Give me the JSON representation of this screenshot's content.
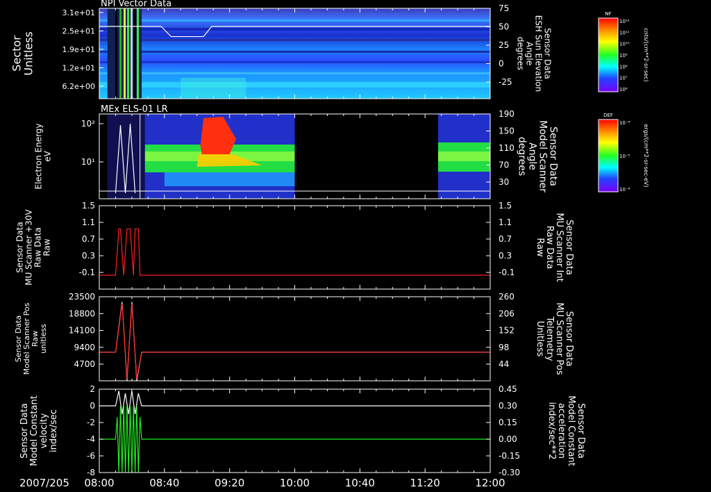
{
  "date_label": "2007/205",
  "x_ticks": [
    "08:00",
    "08:40",
    "09:20",
    "10:00",
    "10:40",
    "11:20",
    "12:00"
  ],
  "colors": {
    "white": "#ffffff",
    "red": "#ff2020",
    "green": "#22ee22",
    "background": "#000000"
  },
  "colorbars": [
    {
      "label": "NF",
      "units": "cnts/(cm**2-sr-sec)",
      "ticks": [
        "10¹²",
        "10¹¹",
        "10¹⁰",
        "10⁹",
        "10⁸",
        "10⁷",
        "10⁶"
      ]
    },
    {
      "label": "DEF",
      "units": "ergs/(cm**2-sr-sec-eV)",
      "ticks": [
        "10⁻⁴",
        "10⁻⁵",
        "10⁻⁶"
      ]
    }
  ],
  "chart_data": [
    {
      "type": "heatmap",
      "title": "NPI Vector Data",
      "ylabel_lines": [
        "Sector",
        "Unitless"
      ],
      "y_ticks": [
        "3.1e+01",
        "2.5e+01",
        "1.9e+01",
        "1.2e+01",
        "6.2e+00"
      ],
      "right_label_lines": [
        "Sensor Data",
        "ESH Sun Elevation",
        "Angle",
        "degrees"
      ],
      "right_ticks": [
        "75",
        "50",
        "25",
        "0",
        "-25"
      ],
      "ylim_right": [
        -50,
        75
      ],
      "overlay": {
        "name": "ESH Sun Elevation Angle",
        "color": "white",
        "x": [
          "08:00",
          "08:19",
          "08:20",
          "08:38",
          "08:44",
          "09:04",
          "09:09",
          "12:00"
        ],
        "y": [
          50,
          50,
          50,
          50,
          36,
          36,
          50,
          50
        ]
      }
    },
    {
      "type": "heatmap",
      "title": "MEx ELS-01 LR",
      "ylabel_lines": [
        "Electron Energy",
        "eV"
      ],
      "y_ticks": [
        "10²",
        "10¹"
      ],
      "ylim": [
        1,
        200
      ],
      "right_label_lines": [
        "Sensor Data",
        "Model Scanner",
        "Angle",
        "degrees"
      ],
      "right_ticks": [
        "190",
        "150",
        "110",
        "70",
        "30"
      ],
      "ylim_right": [
        10,
        190
      ],
      "data_gaps": [
        [
          "10:00",
          "11:28"
        ]
      ]
    },
    {
      "type": "line",
      "ylabel_lines": [
        "Sensor Data",
        "MU Scanner +30V",
        "Raw Data",
        "Raw"
      ],
      "y_ticks": [
        "1.5",
        "1.1",
        "0.7",
        "0.3",
        "-0.1"
      ],
      "ylim": [
        -0.3,
        1.5
      ],
      "right_label_lines": [
        "Sensor Data",
        "MU Scanner Int",
        "Raw Data",
        "Raw"
      ],
      "right_ticks": [
        "1.5",
        "1.1",
        "0.7",
        "0.3",
        "-0.1"
      ],
      "series": [
        {
          "color": "red",
          "x": [
            "08:00",
            "08:10",
            "08:12",
            "08:13",
            "08:15",
            "08:17",
            "08:19",
            "08:21",
            "08:22",
            "08:24",
            "08:25",
            "12:00"
          ],
          "y": [
            0,
            0,
            1,
            1,
            0,
            1,
            1,
            0,
            1,
            1,
            0,
            0
          ]
        }
      ]
    },
    {
      "type": "line",
      "ylabel_lines": [
        "Sensor Data",
        "Model Scanner Pos",
        "Raw",
        "unitless"
      ],
      "y_ticks": [
        "23500",
        "18800",
        "14100",
        "9400",
        "4700"
      ],
      "ylim": [
        0,
        23500
      ],
      "right_label_lines": [
        "Sensor Data",
        "MU Scanner Pos",
        "Telemetry",
        "Unitless"
      ],
      "right_ticks": [
        "260",
        "206",
        "152",
        "98",
        "44"
      ],
      "ylim_right": [
        -10,
        260
      ],
      "series": [
        {
          "color": "white",
          "x": [
            "08:00",
            "08:10",
            "08:14",
            "08:17",
            "08:20",
            "08:23",
            "08:26",
            "12:00"
          ],
          "y": [
            8000,
            8000,
            22000,
            0,
            22000,
            0,
            8000,
            8000
          ]
        },
        {
          "color": "red",
          "x": [
            "08:00",
            "08:10",
            "08:14",
            "08:17",
            "08:20",
            "08:23",
            "08:26",
            "12:00"
          ],
          "y": [
            8000,
            8000,
            21500,
            500,
            21500,
            500,
            8000,
            8000
          ]
        }
      ]
    },
    {
      "type": "line",
      "ylabel_lines": [
        "Sensor Data",
        "Model Constant",
        "velocity",
        "index/sec"
      ],
      "y_ticks": [
        "2",
        "0",
        "-2",
        "-4",
        "-6",
        "-8"
      ],
      "ylim": [
        -8,
        2
      ],
      "right_label_lines": [
        "Sensor Data",
        "Model Constant",
        "acceleration",
        "index/sec**2"
      ],
      "right_ticks": [
        "0.45",
        "0.30",
        "0.15",
        "0.00",
        "-0.15",
        "-0.30"
      ],
      "ylim_right": [
        -0.3,
        0.45
      ],
      "series": [
        {
          "color": "white",
          "x": [
            "08:00",
            "08:10",
            "08:12",
            "08:14",
            "08:16",
            "08:18",
            "08:20",
            "08:22",
            "08:24",
            "08:26",
            "12:00"
          ],
          "y": [
            0,
            0,
            1.8,
            -1,
            1.5,
            -1,
            1.8,
            -1,
            1.5,
            0,
            0
          ]
        },
        {
          "color": "green",
          "x": [
            "08:00",
            "08:10",
            "08:11",
            "08:12",
            "08:13",
            "08:14",
            "08:15",
            "08:16",
            "08:17",
            "08:18",
            "08:19",
            "08:20",
            "08:21",
            "08:22",
            "08:23",
            "08:24",
            "08:25",
            "08:26",
            "12:00"
          ],
          "y": [
            0,
            0,
            0.2,
            -0.3,
            0.3,
            -0.3,
            0.3,
            -0.3,
            0.3,
            -0.3,
            0.3,
            -0.3,
            0.3,
            -0.3,
            0.3,
            -0.3,
            0.2,
            0,
            0
          ]
        }
      ]
    }
  ]
}
